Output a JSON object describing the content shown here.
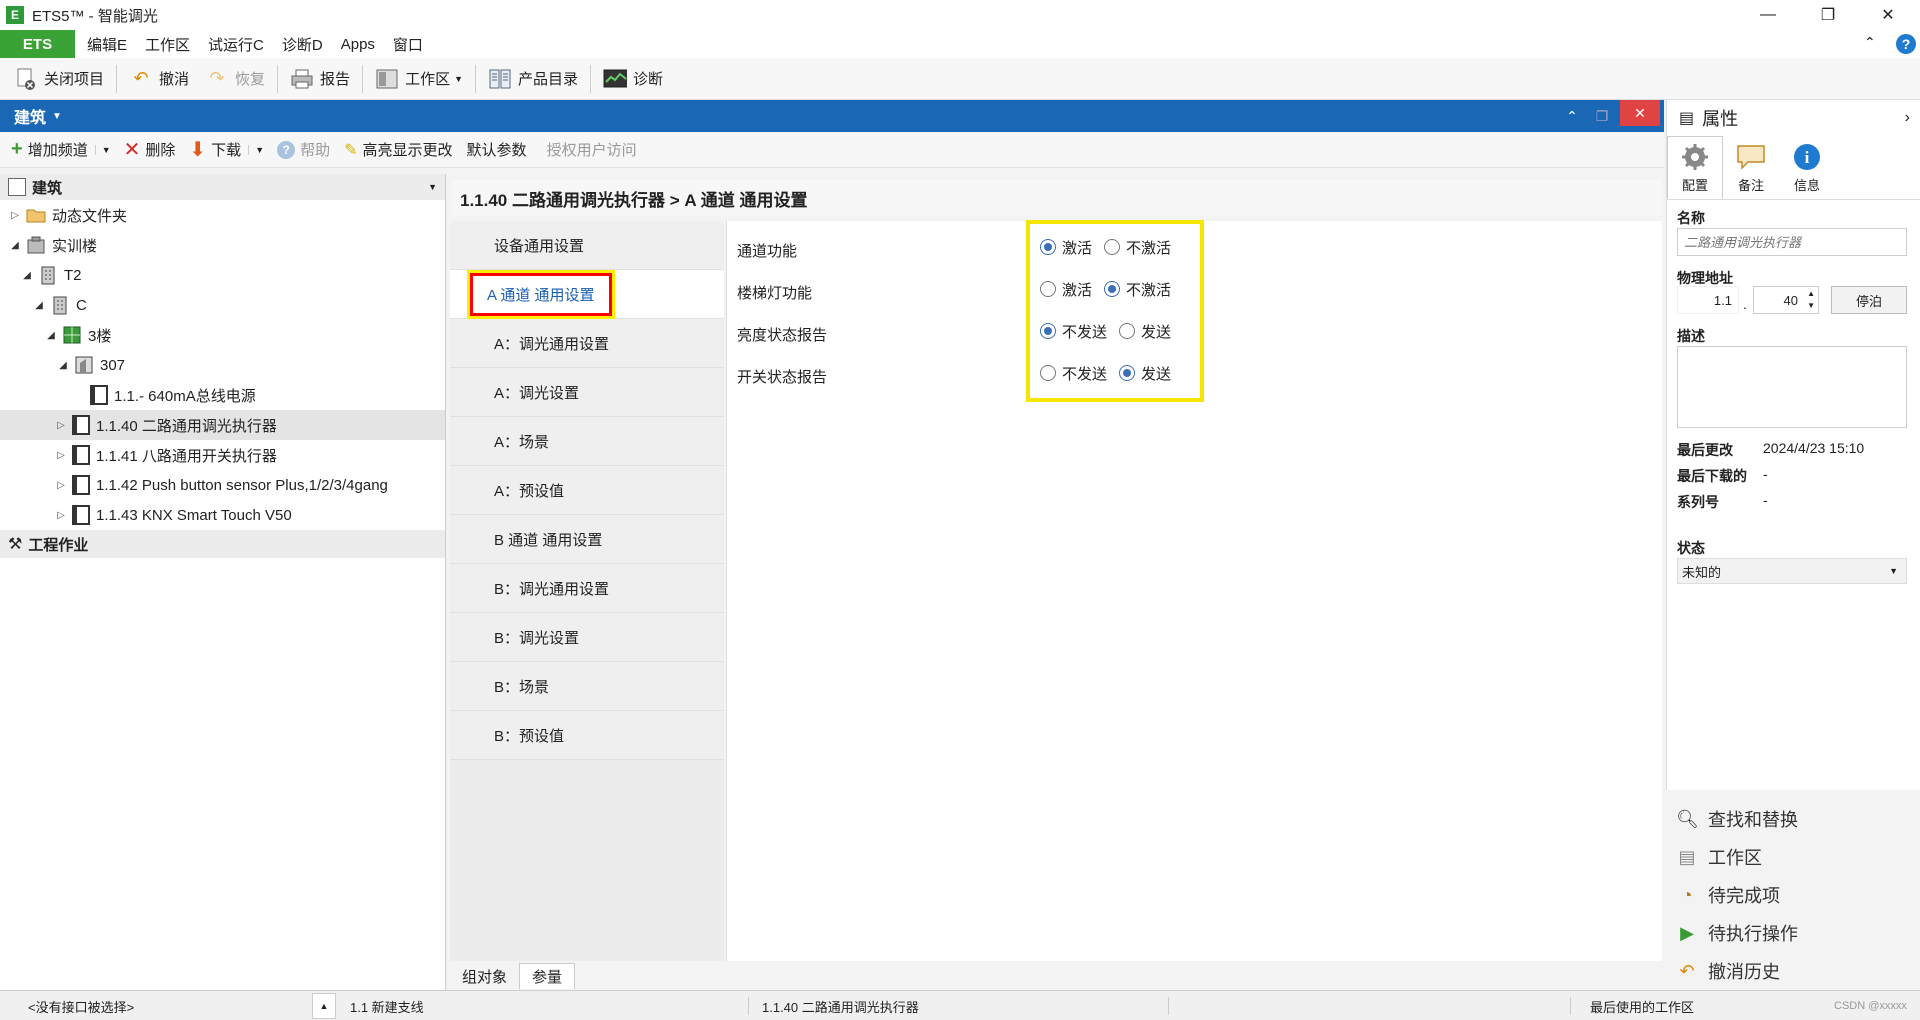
{
  "window": {
    "title": "ETS5™ - 智能调光",
    "app_icon": "ETS"
  },
  "menubar": {
    "ets_tab": "ETS",
    "items": [
      "编辑E",
      "工作区",
      "试运行C",
      "诊断D",
      "Apps",
      "窗口"
    ]
  },
  "toolbar": {
    "close_project": "关闭项目",
    "undo": "撤消",
    "redo": "恢复",
    "report": "报告",
    "workspace": "工作区",
    "catalog": "产品目录",
    "diagnostics": "诊断"
  },
  "panel": {
    "title": "建筑"
  },
  "toolbar2": {
    "add_channel": "增加频道",
    "delete": "删除",
    "download": "下载",
    "help": "帮助",
    "highlight": "高亮显示更改",
    "default_params": "默认参数",
    "authorize": "授权用户访问"
  },
  "tree": {
    "header": "建筑",
    "rows": [
      {
        "label": "动态文件夹"
      },
      {
        "label": "实训楼"
      },
      {
        "label": "T2"
      },
      {
        "label": "C"
      },
      {
        "label": "3楼"
      },
      {
        "label": "307"
      },
      {
        "label": "1.1.- 640mA总线电源"
      },
      {
        "label": "1.1.40 二路通用调光执行器"
      },
      {
        "label": "1.1.41 八路通用开关执行器"
      },
      {
        "label": "1.1.42 Push button sensor Plus,1/2/3/4gang"
      },
      {
        "label": "1.1.43 KNX Smart Touch V50"
      }
    ],
    "section2": "工程作业"
  },
  "breadcrumb": "1.1.40 二路通用调光执行器 > A 通道 通用设置",
  "param_nav": [
    "设备通用设置",
    "A 通道 通用设置",
    "A：调光通用设置",
    "A：调光设置",
    "A：场景",
    "A：预设值",
    "B 通道 通用设置",
    "B：调光通用设置",
    "B：调光设置",
    "B：场景",
    "B：预设值"
  ],
  "params": [
    {
      "label": "通道功能",
      "opt1": "激活",
      "opt2": "不激活",
      "selected": 1
    },
    {
      "label": "楼梯灯功能",
      "opt1": "激活",
      "opt2": "不激活",
      "selected": 2
    },
    {
      "label": "亮度状态报告",
      "opt1": "不发送",
      "opt2": "发送",
      "selected": 1
    },
    {
      "label": "开关状态报告",
      "opt1": "不发送",
      "opt2": "发送",
      "selected": 2
    }
  ],
  "bottom_tabs": [
    "组对象",
    "参量"
  ],
  "properties": {
    "title": "属性",
    "tabs": [
      "配置",
      "备注",
      "信息"
    ],
    "name_label": "名称",
    "name_placeholder": "二路通用调光执行器",
    "phys_label": "物理地址",
    "phys_prefix": "1.1",
    "phys_sep": ".",
    "phys_value": "40",
    "park_button": "停泊",
    "desc_label": "描述",
    "last_modified_label": "最后更改",
    "last_modified_value": "2024/4/23 15:10",
    "last_download_label": "最后下载的",
    "last_download_value": "-",
    "serial_label": "系列号",
    "serial_value": "-",
    "status_label": "状态",
    "status_value": "未知的"
  },
  "side_nav": [
    "查找和替换",
    "工作区",
    "待完成项",
    "待执行操作",
    "撤消历史"
  ],
  "statusbar": {
    "interface": "<没有接口被选择>",
    "line": "1.1 新建支线",
    "device": "1.1.40 二路通用调光执行器",
    "workspace": "最后使用的工作区",
    "watermark": "CSDN @xxxxx"
  }
}
